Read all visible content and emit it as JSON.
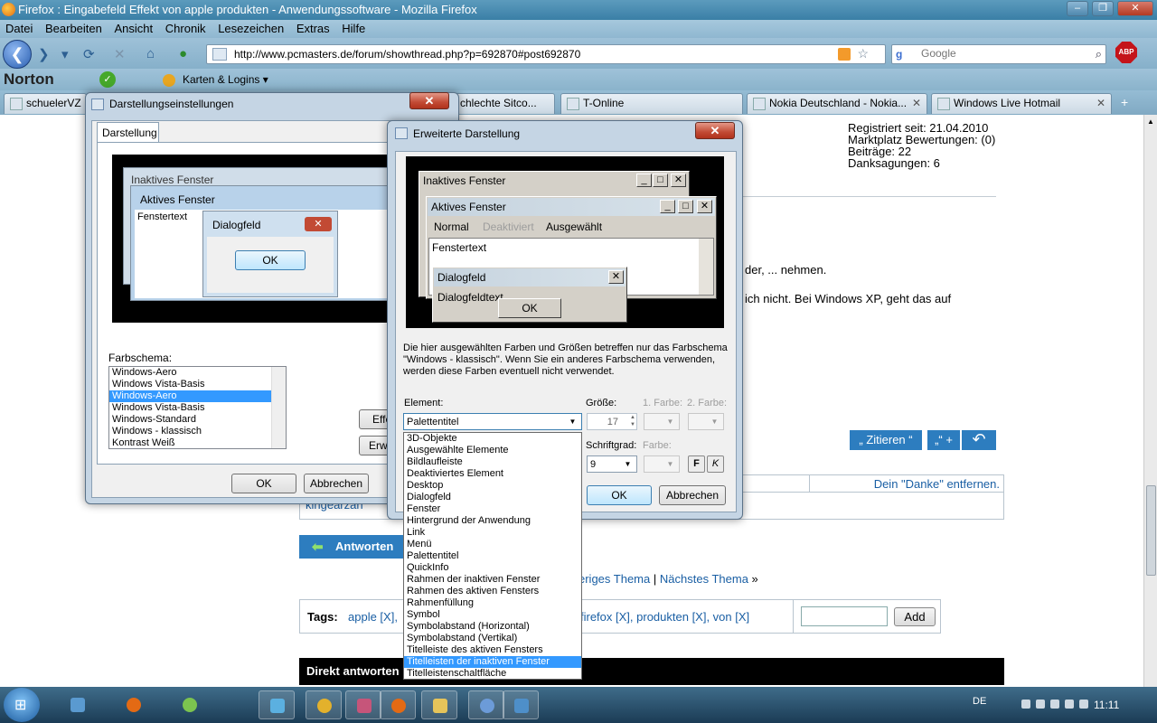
{
  "browser": {
    "title": "Firefox : Eingabefeld Effekt von apple produkten - Anwendungssoftware - Mozilla Firefox",
    "menu": [
      "Datei",
      "Bearbeiten",
      "Ansicht",
      "Chronik",
      "Lesezeichen",
      "Extras",
      "Hilfe"
    ],
    "url": "http://www.pcmasters.de/forum/showthread.php?p=692870#post692870",
    "search_placeholder": "Google",
    "abp": "ABP",
    "norton_label": "Norton",
    "logins_label": "Karten & Logins",
    "tabs": [
      "schuelerVZ",
      "chlechte Sitco...",
      "T-Online",
      "Nokia Deutschland - Nokia...",
      "Windows Live Hotmail"
    ],
    "tabs_more": "+"
  },
  "forum": {
    "userinfo": [
      "Registriert seit: 21.04.2010",
      "Marktplatz Bewertungen: (0)",
      "Beiträge: 22",
      "Danksagungen: 6"
    ],
    "post_line1": "der, ... nehmen.",
    "post_line2": "ich nicht. Bei Windows XP, geht das auf",
    "quote_label": "„ Zitieren “",
    "multiquote_label": "„“ +",
    "thanks_remove": "Dein \"Danke\" entfernen.",
    "thanks_names": "kingearzah",
    "reply_label": "Antworten",
    "thread_nav_prev": "eriges Thema",
    "thread_nav_sep": "|",
    "thread_nav_next": "Nächstes Thema",
    "thread_nav_arrow": "»",
    "tags_label": "Tags:",
    "tags_left": "apple [X],",
    "tags_right": "firefox [X], produkten [X], von [X]",
    "add_label": "Add",
    "direct_reply": "Direkt antworten"
  },
  "dialog_display": {
    "title": "Darstellungseinstellungen",
    "tab": "Darstellung",
    "inactive_window": "Inaktives Fenster",
    "active_window": "Aktives Fenster",
    "window_text": "Fenstertext",
    "dialog_box": "Dialogfeld",
    "ok_preview": "OK",
    "color_scheme_label": "Farbschema:",
    "color_schemes": [
      "Windows-Aero",
      "Windows Vista-Basis",
      "Windows-Aero",
      "Windows Vista-Basis",
      "Windows-Standard",
      "Windows - klassisch",
      "Kontrast Weiß"
    ],
    "selected_scheme_index": 2,
    "effects_btn": "Effe",
    "advanced_btn": "Erwe",
    "ok": "OK",
    "cancel": "Abbrechen"
  },
  "dialog_advanced": {
    "title": "Erweiterte Darstellung",
    "inactive_window": "Inaktives Fenster",
    "active_window": "Aktives Fenster",
    "menu_normal": "Normal",
    "menu_disabled": "Deaktiviert",
    "menu_selected": "Ausgewählt",
    "window_text": "Fenstertext",
    "dialog_box": "Dialogfeld",
    "dialog_text": "Dialogfeldtext",
    "ok_preview": "OK",
    "info": "Die hier ausgewählten Farben und Größen betreffen nur das Farbschema \"Windows - klassisch\". Wenn Sie ein anderes Farbschema verwenden, werden diese Farben eventuell nicht verwendet.",
    "element_label": "Element:",
    "size_label": "Größe:",
    "color1_label": "1. Farbe:",
    "color2_label": "2. Farbe:",
    "element_value": "Palettentitel",
    "size_value": "17",
    "fontsize_label": "Schriftgrad:",
    "color_label": "Farbe:",
    "fontsize_value": "9",
    "bold": "F",
    "italic": "K",
    "ok": "OK",
    "cancel": "Abbrechen",
    "element_options": [
      "3D-Objekte",
      "Ausgewählte Elemente",
      "Bildlaufleiste",
      "Deaktiviertes Element",
      "Desktop",
      "Dialogfeld",
      "Fenster",
      "Hintergrund der Anwendung",
      "Link",
      "Menü",
      "Palettentitel",
      "QuickInfo",
      "Rahmen der inaktiven Fenster",
      "Rahmen des aktiven Fensters",
      "Rahmenfüllung",
      "Symbol",
      "Symbolabstand (Horizontal)",
      "Symbolabstand (Vertikal)",
      "Titelleiste des aktiven Fensters",
      "Titelleisten der inaktiven Fenster",
      "Titelleistenschaltfläche"
    ],
    "highlighted_option_index": 19
  },
  "taskbar": {
    "language": "DE",
    "clock": "11:11"
  },
  "colors": {
    "link": "#1a5fa4",
    "selection": "#3399ff",
    "forum_button": "#2d7dbf"
  }
}
